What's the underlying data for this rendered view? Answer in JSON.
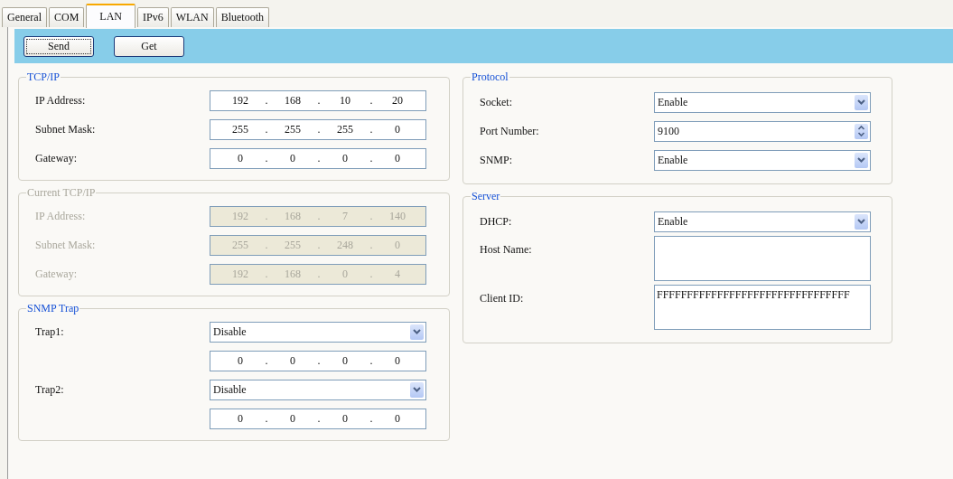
{
  "tabs": [
    {
      "label": "General",
      "selected": false
    },
    {
      "label": "COM",
      "selected": false
    },
    {
      "label": "LAN",
      "selected": true
    },
    {
      "label": "IPv6",
      "selected": false
    },
    {
      "label": "WLAN",
      "selected": false
    },
    {
      "label": "Bluetooth",
      "selected": false
    }
  ],
  "buttons": [
    {
      "label": "Send",
      "focused": true
    },
    {
      "label": "Get",
      "focused": false
    }
  ],
  "left_groups": [
    {
      "title": "TCP/IP",
      "disabled": false,
      "rows": [
        {
          "label": "IP Address:",
          "kind": "ip",
          "separator": ".",
          "octets": [
            "192",
            "168",
            "10",
            "20"
          ]
        },
        {
          "label": "Subnet Mask:",
          "kind": "ip",
          "separator": ".",
          "octets": [
            "255",
            "255",
            "255",
            "0"
          ]
        },
        {
          "label": "Gateway:",
          "kind": "ip",
          "separator": ".",
          "octets": [
            "0",
            "0",
            "0",
            "0"
          ]
        }
      ]
    },
    {
      "title": "Current TCP/IP",
      "disabled": true,
      "rows": [
        {
          "label": "IP Address:",
          "kind": "ip",
          "separator": ".",
          "octets": [
            "192",
            "168",
            "7",
            "140"
          ]
        },
        {
          "label": "Subnet Mask:",
          "kind": "ip",
          "separator": ".",
          "octets": [
            "255",
            "255",
            "248",
            "0"
          ]
        },
        {
          "label": "Gateway:",
          "kind": "ip",
          "separator": ".",
          "octets": [
            "192",
            "168",
            "0",
            "4"
          ]
        }
      ]
    },
    {
      "title": "SNMP Trap",
      "disabled": false,
      "rows": [
        {
          "label": "Trap1:",
          "kind": "select",
          "value": "Disable"
        },
        {
          "kind": "ip",
          "separator": ".",
          "octets": [
            "0",
            "0",
            "0",
            "0"
          ]
        },
        {
          "label": "Trap2:",
          "kind": "select",
          "value": "Disable"
        },
        {
          "kind": "ip",
          "separator": ".",
          "octets": [
            "0",
            "0",
            "0",
            "0"
          ]
        }
      ]
    }
  ],
  "right_groups": [
    {
      "title": "Protocol",
      "disabled": false,
      "rows": [
        {
          "label": "Socket:",
          "kind": "select",
          "value": "Enable"
        },
        {
          "label": "Port Number:",
          "kind": "spin",
          "value": "9100"
        },
        {
          "label": "SNMP:",
          "kind": "select",
          "value": "Enable"
        }
      ]
    },
    {
      "title": "Server",
      "disabled": false,
      "rows": [
        {
          "label": "DHCP:",
          "kind": "select",
          "value": "Enable"
        },
        {
          "label": "Host Name:",
          "kind": "textarea"
        },
        {
          "label": "Client ID:",
          "kind": "textarea",
          "value": "FFFFFFFFFFFFFFFFFFFFFFFFFFFFFFFF"
        }
      ]
    }
  ]
}
